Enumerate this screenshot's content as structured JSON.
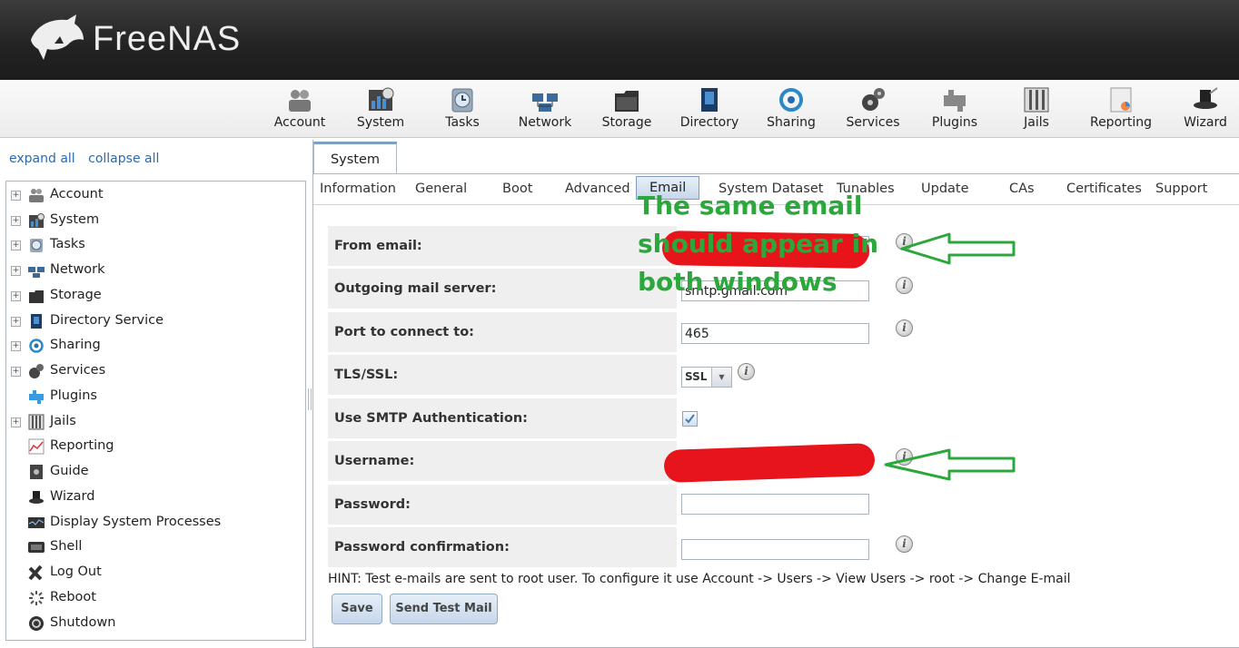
{
  "app": {
    "brand": "FreeNAS"
  },
  "topnav": [
    {
      "id": "account",
      "label": "Account",
      "icon": "account-icon"
    },
    {
      "id": "system",
      "label": "System",
      "icon": "system-icon"
    },
    {
      "id": "tasks",
      "label": "Tasks",
      "icon": "tasks-icon"
    },
    {
      "id": "network",
      "label": "Network",
      "icon": "network-icon"
    },
    {
      "id": "storage",
      "label": "Storage",
      "icon": "storage-icon"
    },
    {
      "id": "directory",
      "label": "Directory",
      "icon": "directory-icon"
    },
    {
      "id": "sharing",
      "label": "Sharing",
      "icon": "sharing-icon"
    },
    {
      "id": "services",
      "label": "Services",
      "icon": "services-icon"
    },
    {
      "id": "plugins",
      "label": "Plugins",
      "icon": "plugins-icon"
    },
    {
      "id": "jails",
      "label": "Jails",
      "icon": "jails-icon"
    },
    {
      "id": "reporting",
      "label": "Reporting",
      "icon": "reporting-icon"
    },
    {
      "id": "wizard",
      "label": "Wizard",
      "icon": "wizard-icon"
    }
  ],
  "sidebar": {
    "expand_all": "expand all",
    "collapse_all": "collapse all",
    "items": [
      {
        "label": "Account",
        "expandable": true
      },
      {
        "label": "System",
        "expandable": true
      },
      {
        "label": "Tasks",
        "expandable": true
      },
      {
        "label": "Network",
        "expandable": true
      },
      {
        "label": "Storage",
        "expandable": true
      },
      {
        "label": "Directory Service",
        "expandable": true
      },
      {
        "label": "Sharing",
        "expandable": true
      },
      {
        "label": "Services",
        "expandable": true
      },
      {
        "label": "Plugins",
        "expandable": false
      },
      {
        "label": "Jails",
        "expandable": true
      },
      {
        "label": "Reporting",
        "expandable": false
      },
      {
        "label": "Guide",
        "expandable": false
      },
      {
        "label": "Wizard",
        "expandable": false
      },
      {
        "label": "Display System Processes",
        "expandable": false
      },
      {
        "label": "Shell",
        "expandable": false
      },
      {
        "label": "Log Out",
        "expandable": false
      },
      {
        "label": "Reboot",
        "expandable": false
      },
      {
        "label": "Shutdown",
        "expandable": false
      }
    ]
  },
  "main": {
    "tab": "System",
    "subtabs": [
      "Information",
      "General",
      "Boot",
      "Advanced",
      "Email",
      "System Dataset",
      "Tunables",
      "Update",
      "CAs",
      "Certificates",
      "Support"
    ],
    "active_subtab": "Email",
    "form": {
      "from_email": {
        "label": "From email:",
        "value": ""
      },
      "outgoing_server": {
        "label": "Outgoing mail server:",
        "value": "smtp.gmail.com"
      },
      "port": {
        "label": "Port to connect to:",
        "value": "465"
      },
      "tls": {
        "label": "TLS/SSL:",
        "value": "SSL"
      },
      "smtp_auth": {
        "label": "Use SMTP Authentication:",
        "checked": true
      },
      "username": {
        "label": "Username:",
        "value": ""
      },
      "password": {
        "label": "Password:",
        "value": ""
      },
      "password_confirm": {
        "label": "Password confirmation:",
        "value": ""
      }
    },
    "hint": "HINT: Test e-mails are sent to root user. To configure it use Account -> Users -> View Users -> root -> Change E-mail",
    "buttons": {
      "save": "Save",
      "send_test": "Send Test Mail"
    }
  },
  "annotation": {
    "line1": "The same email",
    "line2": "should appear in",
    "line3": "both windows"
  },
  "colors": {
    "annotation": "#2ca73c",
    "redaction": "#e8141c",
    "link": "#2a6ab0"
  }
}
